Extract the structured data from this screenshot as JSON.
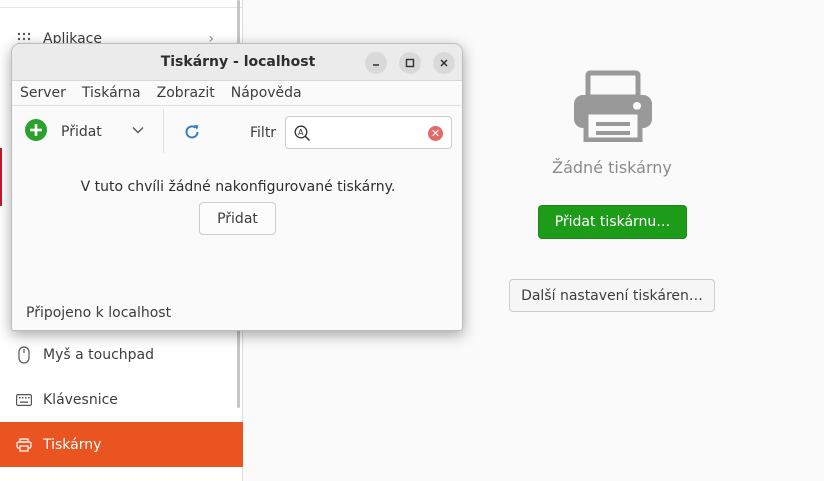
{
  "sidebar": {
    "items": [
      {
        "label": "Aplikace",
        "icon": "grid-icon"
      },
      {
        "label": "Myš a touchpad",
        "icon": "mouse-icon"
      },
      {
        "label": "Klávesnice",
        "icon": "keyboard-icon"
      },
      {
        "label": "Tiskárny",
        "icon": "printer-icon",
        "active": true
      }
    ],
    "active_color": "#e95420"
  },
  "main": {
    "empty_title": "Žádné tiskárny",
    "add_button": "Přidat tiskárnu…",
    "more_button": "Další nastavení tiskáren…",
    "accent_green": "#1d9c1a"
  },
  "dialog": {
    "title": "Tiskárny - localhost",
    "menu": [
      "Server",
      "Tiskárna",
      "Zobrazit",
      "Nápověda"
    ],
    "toolbar": {
      "add_label": "Přidat",
      "filter_label": "Filtr",
      "filter_value": ""
    },
    "empty_message": "V tuto chvíli žádné nakonfigurované tiskárny.",
    "add_button": "Přidat",
    "status": "Připojeno k localhost"
  }
}
